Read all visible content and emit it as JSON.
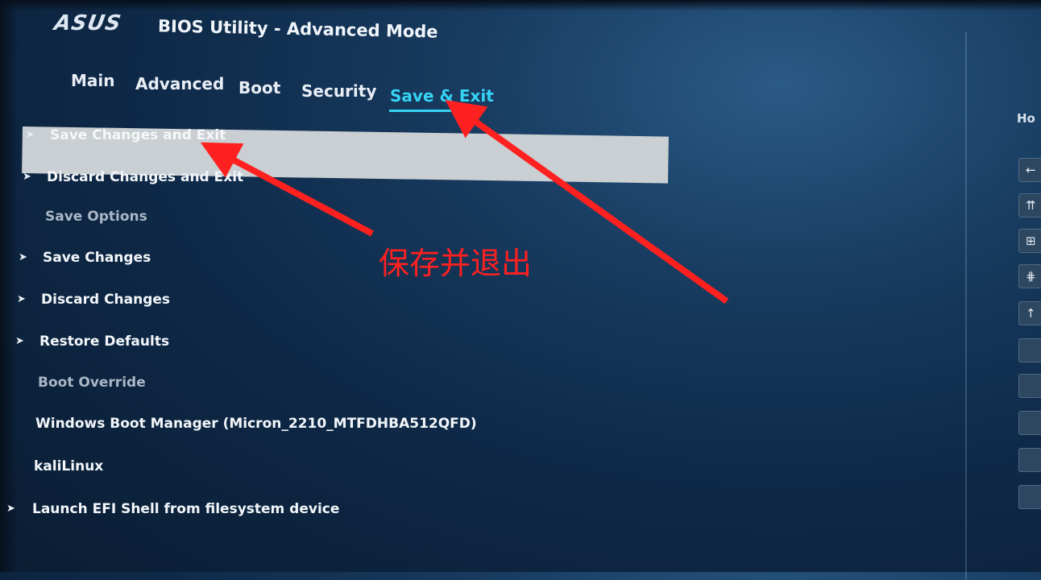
{
  "header": {
    "logo_text": "ASUS",
    "title": "BIOS Utility - Advanced Mode"
  },
  "tabs": [
    {
      "label": "Main",
      "active": false
    },
    {
      "label": "Advanced",
      "active": false
    },
    {
      "label": "Boot",
      "active": false
    },
    {
      "label": "Security",
      "active": false
    },
    {
      "label": "Save & Exit",
      "active": true
    }
  ],
  "menu": {
    "items": [
      {
        "label": "Save Changes and Exit",
        "has_arrow": true,
        "selected": true
      },
      {
        "label": "Discard Changes and Exit",
        "has_arrow": true
      },
      {
        "label": "Save Options",
        "section": true
      },
      {
        "label": "Save Changes",
        "has_arrow": true
      },
      {
        "label": "Discard Changes",
        "has_arrow": true
      },
      {
        "label": "Restore Defaults",
        "has_arrow": true
      },
      {
        "label": "Boot Override",
        "section": true
      },
      {
        "label": "Windows Boot Manager (Micron_2210_MTFDHBA512QFD)",
        "has_arrow": false
      },
      {
        "label": "kaliLinux",
        "has_arrow": false
      },
      {
        "label": "Launch EFI Shell from filesystem device",
        "has_arrow": true
      }
    ],
    "arrow_glyph": "➤"
  },
  "right_panel": {
    "title_fragment": "Ho",
    "hotkeys": [
      "←",
      "⇈",
      "⊞",
      "⋕",
      "↑",
      "",
      "",
      "",
      "",
      ""
    ]
  },
  "annotation": {
    "text": "保存并退出",
    "color": "#ff2020"
  },
  "colors": {
    "accent": "#35d4f5",
    "selected_bar": "#c9cfd2",
    "background": "#173a5e"
  }
}
